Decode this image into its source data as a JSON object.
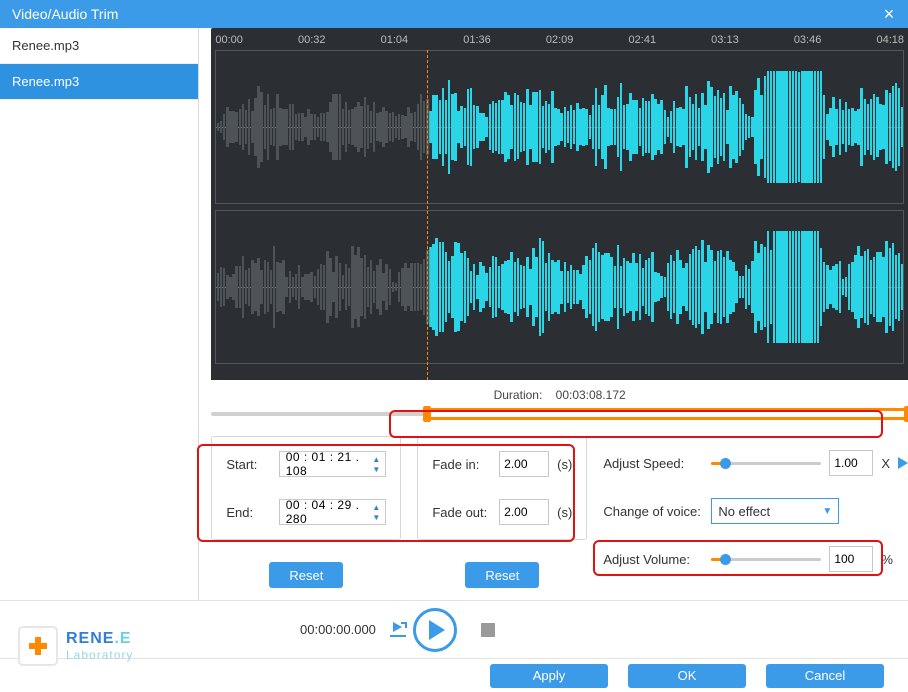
{
  "window": {
    "title": "Video/Audio Trim",
    "close": "×"
  },
  "sidebar": {
    "items": [
      "Renee.mp3",
      "Renee.mp3"
    ],
    "active_index": 1
  },
  "timeline_ticks": [
    "00:00",
    "00:32",
    "01:04",
    "01:36",
    "02:09",
    "02:41",
    "03:13",
    "03:46",
    "04:18"
  ],
  "duration": {
    "label": "Duration:",
    "value": "00:03:08.172"
  },
  "trim": {
    "start_label": "Start:",
    "start_value": "00 : 01 : 21 . 108",
    "end_label": "End:",
    "end_value": "00 : 04 : 29 . 280",
    "reset": "Reset"
  },
  "fade": {
    "in_label": "Fade in:",
    "in_value": "2.00",
    "unit": "(s)",
    "out_label": "Fade out:",
    "out_value": "2.00",
    "reset": "Reset"
  },
  "right": {
    "speed_label": "Adjust Speed:",
    "speed_value": "1.00",
    "speed_unit": "X",
    "voice_label": "Change of voice:",
    "voice_value": "No effect",
    "volume_label": "Adjust Volume:",
    "volume_value": "100",
    "volume_unit": "%"
  },
  "playback": {
    "time": "00:00:00.000"
  },
  "footer": {
    "apply": "Apply",
    "ok": "OK",
    "cancel": "Cancel"
  },
  "logo": {
    "line1a": "RENE",
    "line1b": ".E",
    "line2": "Laboratory"
  },
  "selection": {
    "start_pct": 31,
    "end_pct": 100
  }
}
